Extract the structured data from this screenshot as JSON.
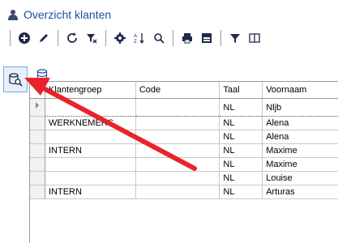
{
  "window": {
    "title": "Overzicht klanten"
  },
  "colors": {
    "accent": "#1f4e9e",
    "annotation_arrow": "#e8242a"
  },
  "toolbar": {
    "buttons": [
      "add-icon",
      "edit-icon",
      "refresh-icon",
      "clear-filter-icon",
      "settings-icon",
      "sort-icon",
      "search-icon",
      "print-icon",
      "export-icon",
      "filter-icon",
      "columns-icon"
    ]
  },
  "grid": {
    "columns": [
      "Klantengroep",
      "Code",
      "Taal",
      "Voornaam"
    ],
    "rows": [
      {
        "klantengroep": "",
        "code": "",
        "taal": "NL",
        "voornaam": "Nljb"
      },
      {
        "klantengroep": "WERKNEMERS",
        "code": "",
        "taal": "NL",
        "voornaam": "Alena"
      },
      {
        "klantengroep": "",
        "code": "",
        "taal": "NL",
        "voornaam": "Alena"
      },
      {
        "klantengroep": "INTERN",
        "code": "",
        "taal": "NL",
        "voornaam": "Maxime"
      },
      {
        "klantengroep": "",
        "code": "",
        "taal": "NL",
        "voornaam": "Maxime"
      },
      {
        "klantengroep": "",
        "code": "",
        "taal": "NL",
        "voornaam": "Louise"
      },
      {
        "klantengroep": "INTERN",
        "code": "",
        "taal": "NL",
        "voornaam": "Arturas"
      }
    ]
  }
}
